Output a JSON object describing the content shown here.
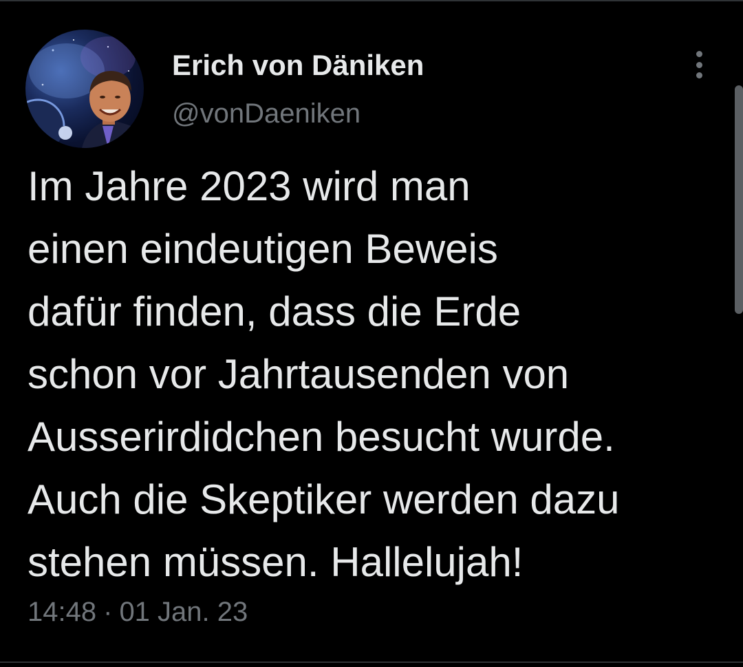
{
  "author": {
    "name": "Erich von Däniken",
    "handle": "@vonDaeniken",
    "avatar_icon": "profile-photo"
  },
  "tweet": {
    "lines": [
      "Im Jahre 2023 wird man",
      "einen eindeutigen Beweis",
      "dafür finden, dass die Erde",
      "schon vor Jahrtausenden von",
      "Ausserirdidchen besucht wurde.",
      "Auch die Skeptiker werden dazu",
      "stehen müssen. Hallelujah!"
    ],
    "time": "14:48",
    "separator": "·",
    "date": "01 Jan. 23"
  },
  "icons": {
    "more": "more-vertical-icon"
  },
  "colors": {
    "background": "#000000",
    "text_primary": "#e7e9ea",
    "text_secondary": "#71767b",
    "divider": "#2f3336"
  }
}
